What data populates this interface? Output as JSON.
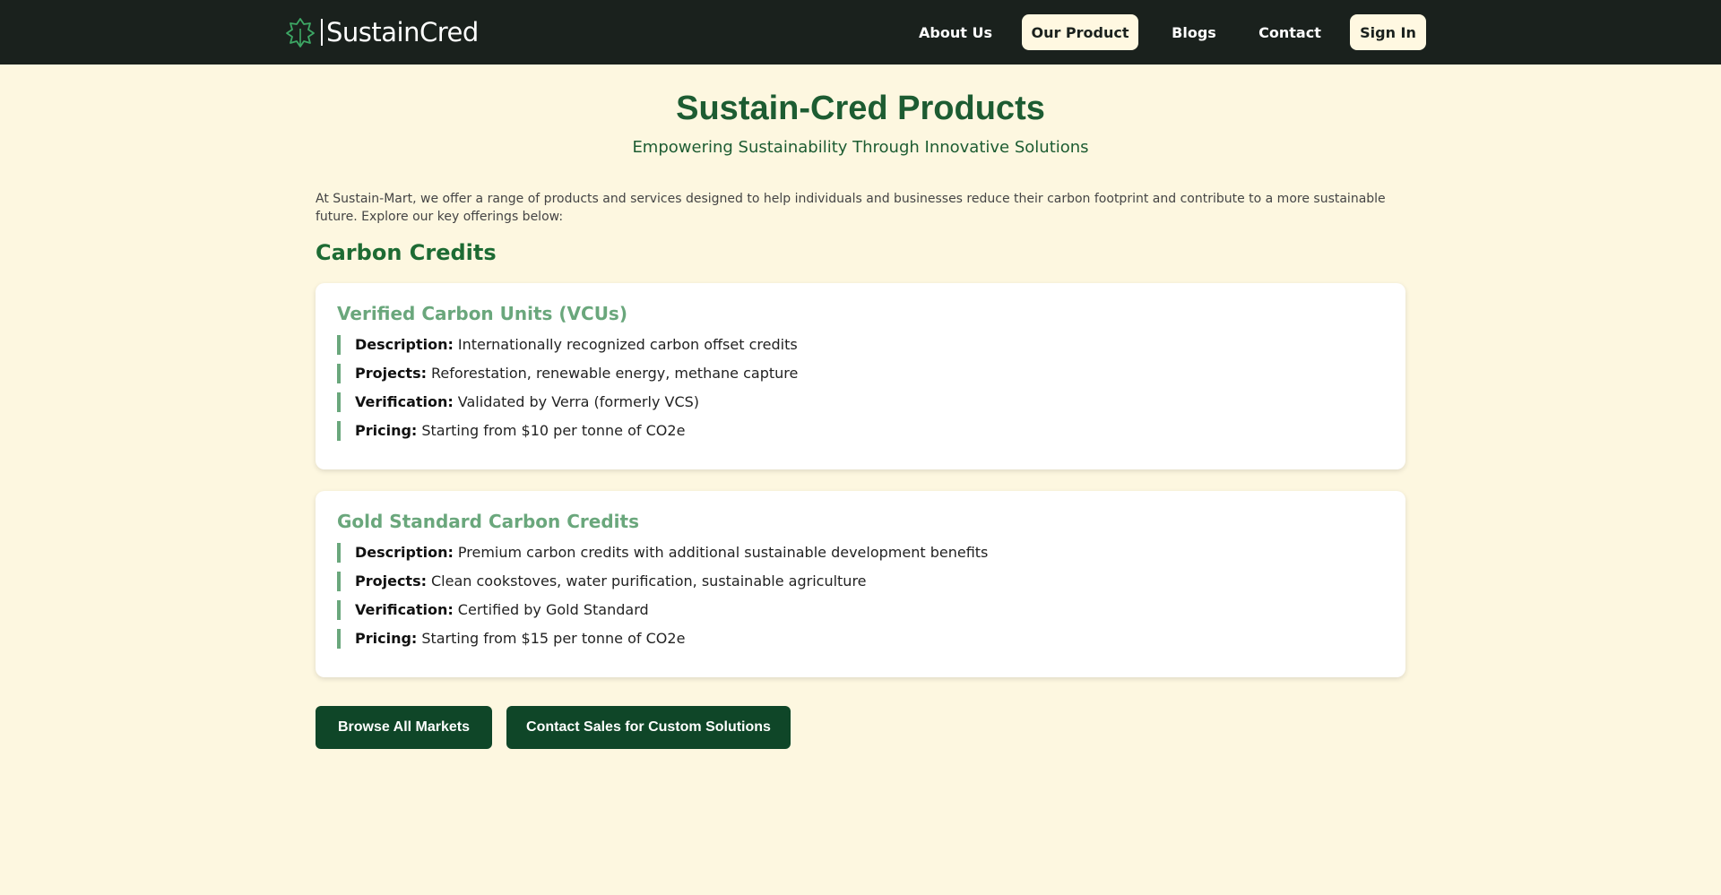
{
  "header": {
    "brand_name": "SustainCred",
    "nav": [
      {
        "label": "About Us"
      },
      {
        "label": "Our Product"
      },
      {
        "label": "Blogs"
      },
      {
        "label": "Contact"
      }
    ],
    "signin_label": "Sign In"
  },
  "main": {
    "title": "Sustain-Cred Products",
    "subtitle": "Empowering Sustainability Through Innovative Solutions",
    "intro": "At Sustain-Mart, we offer a range of products and services designed to help individuals and businesses reduce their carbon footprint and contribute to a more sustainable future. Explore our key offerings below:",
    "section_heading": "Carbon Credits",
    "cards": [
      {
        "title": "Verified Carbon Units (VCUs)",
        "items": [
          {
            "label": "Description:",
            "value": "Internationally recognized carbon offset credits"
          },
          {
            "label": "Projects:",
            "value": "Reforestation, renewable energy, methane capture"
          },
          {
            "label": "Verification:",
            "value": "Validated by Verra (formerly VCS)"
          },
          {
            "label": "Pricing:",
            "value": "Starting from $10 per tonne of CO2e"
          }
        ]
      },
      {
        "title": "Gold Standard Carbon Credits",
        "items": [
          {
            "label": "Description:",
            "value": "Premium carbon credits with additional sustainable development benefits"
          },
          {
            "label": "Projects:",
            "value": "Clean cookstoves, water purification, sustainable agriculture"
          },
          {
            "label": "Verification:",
            "value": "Certified by Gold Standard"
          },
          {
            "label": "Pricing:",
            "value": "Starting from $15 per tonne of CO2e"
          }
        ]
      }
    ],
    "buttons": {
      "browse_label": "Browse All Markets",
      "contact_sales_label": "Contact Sales for Custom Solutions"
    }
  },
  "colors": {
    "nav_bg": "#1a211d",
    "page_bg": "#fdf7e0",
    "title_green": "#1d5c32",
    "accent_green": "#6aa77c",
    "button_green": "#0f4628"
  },
  "icons": {
    "logo": "leaf-logo-icon"
  }
}
